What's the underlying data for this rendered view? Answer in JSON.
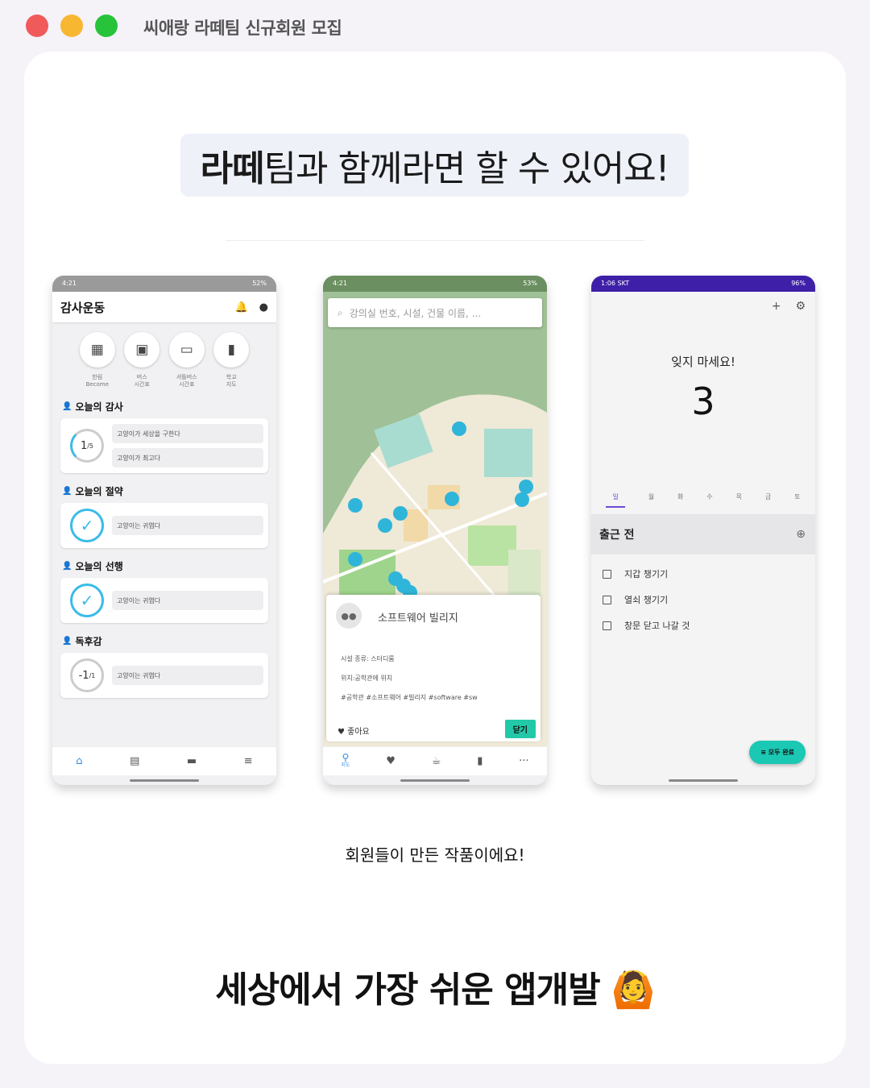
{
  "window": {
    "title": "씨애랑 라떼팀 신규회원 모집"
  },
  "headline": {
    "bold": "라떼",
    "rest": "팀과 함께라면 할 수 있어요!"
  },
  "phone1": {
    "status_time": "4:21",
    "status_battery": "52%",
    "app_title": "감사운동",
    "quick_actions": [
      {
        "icon": "calendar-icon",
        "label": "한림\nBecome"
      },
      {
        "icon": "bus-icon",
        "label": "버스\n시간표"
      },
      {
        "icon": "shuttle-icon",
        "label": "셔틀버스\n시간표"
      },
      {
        "icon": "map-icon",
        "label": "학교\n지도"
      }
    ],
    "sections": [
      {
        "title": "오늘의 감사",
        "progress": "1",
        "progress_total": "/5",
        "items": [
          "고양이가 세상을 구한다",
          "고양이가 최고다"
        ]
      },
      {
        "title": "오늘의 절약",
        "items": [
          "고양이는 귀엽다"
        ]
      },
      {
        "title": "오늘의 선행",
        "items": [
          "고양이는 귀엽다"
        ]
      },
      {
        "title": "독후감",
        "progress": "-1",
        "progress_total": "/1",
        "items": [
          "고양이는 귀엽다"
        ]
      }
    ]
  },
  "phone2": {
    "status_time": "4:21",
    "status_battery": "53%",
    "search_placeholder": "강의실 번호, 시설, 건물 이름, ...",
    "sheet": {
      "name": "소프트웨어 빌리지",
      "facility": "시설 종류: 스터디룸",
      "location": "위치:공학관에 위치",
      "tags": "#공학관 #소프트웨어 #빌리지 #software #sw",
      "like_label": "좋아요",
      "close_label": "닫기"
    },
    "nav_active_label": "지도"
  },
  "phone3": {
    "status_time": "1:06 SKT",
    "status_battery": "96%",
    "remember_label": "잊지 마세요!",
    "count": "3",
    "days": [
      "일",
      "월",
      "화",
      "수",
      "목",
      "금",
      "토"
    ],
    "group_title": "출근 전",
    "tasks": [
      "지갑 챙기기",
      "열쇠 챙기기",
      "창문 닫고 나갈 것"
    ],
    "fab_label": "모두 완료"
  },
  "caption": "회원들이 만든 작품이에요!",
  "footer": {
    "text": "세상에서 가장 쉬운 앱개발",
    "emoji": "🙆"
  },
  "colors": {
    "accent_teal": "#1bc8b4",
    "accent_blue": "#3bbbe8",
    "accent_purple": "#3e20a8"
  }
}
